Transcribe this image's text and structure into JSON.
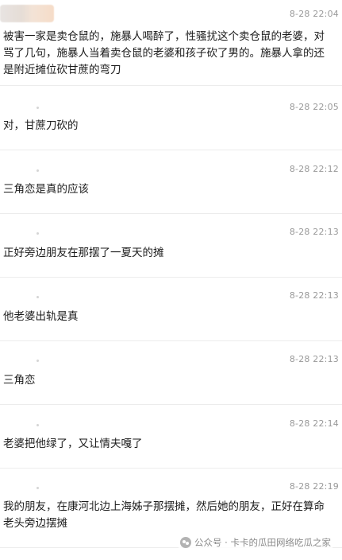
{
  "comments": [
    {
      "timestamp": "8-28 22:04",
      "text": "被害一家是卖仓鼠的，施暴人喝醉了，性骚扰这个卖仓鼠的老婆，对骂了几句，施暴人当着卖仓鼠的老婆和孩子砍了男的。施暴人拿的还是附近摊位砍甘蔗的弯刀"
    },
    {
      "timestamp": "8-28 22:05",
      "text": "对，甘蔗刀砍的"
    },
    {
      "timestamp": "8-28 22:12",
      "text": "三角恋是真的应该"
    },
    {
      "timestamp": "8-28 22:13",
      "text": "正好旁边朋友在那摆了一夏天的摊"
    },
    {
      "timestamp": "8-28 22:13",
      "text": "他老婆出轨是真"
    },
    {
      "timestamp": "8-28 22:13",
      "text": "三角恋"
    },
    {
      "timestamp": "8-28 22:14",
      "text": "老婆把他绿了，又让情夫嘎了"
    },
    {
      "timestamp": "8-28 22:19",
      "text": "我的朋友，在康河北边上海姊子那摆摊，然后她的朋友，正好在算命老头旁边摆摊"
    }
  ],
  "watermark": {
    "text": "公众号 · 卡卡的瓜田网络吃瓜之家",
    "icon": "wechat-icon"
  }
}
